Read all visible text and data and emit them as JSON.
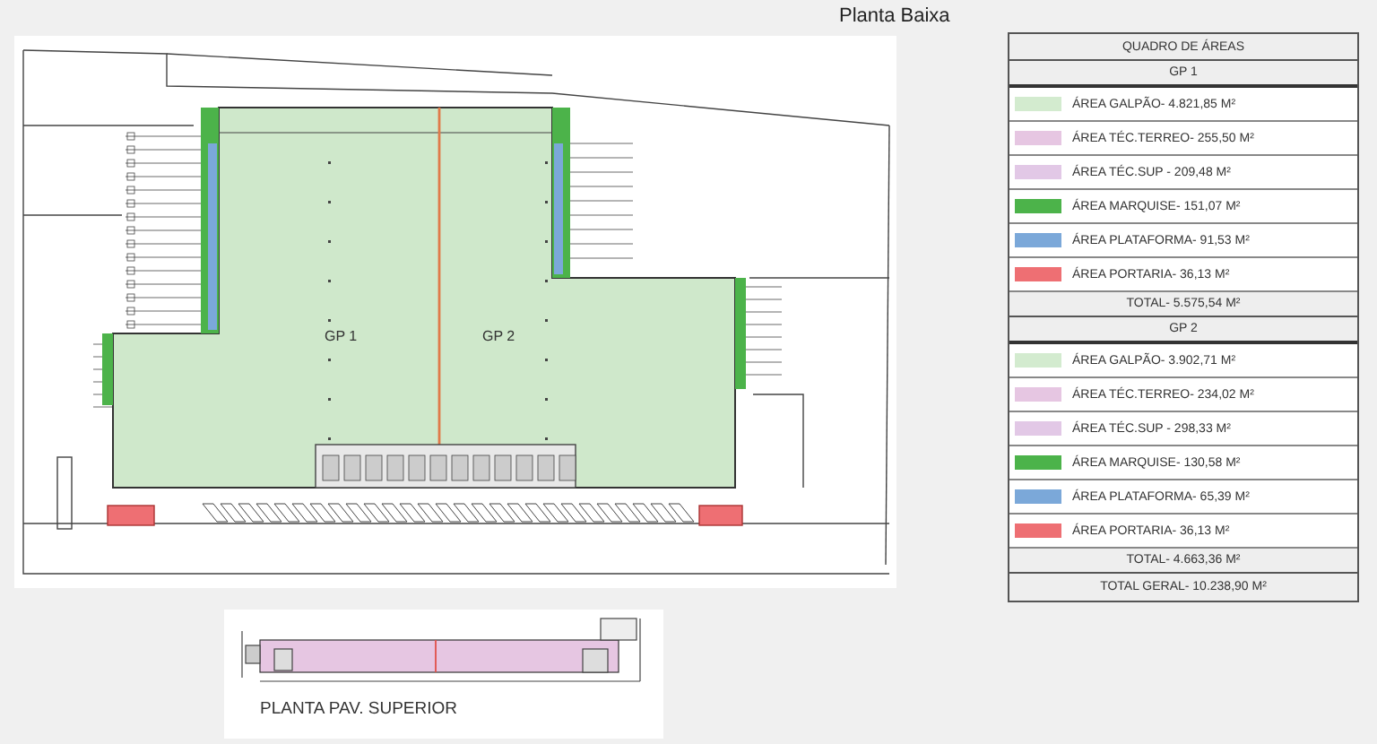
{
  "title": "Planta Baixa",
  "plan": {
    "labels": [
      "GP 1",
      "GP 2"
    ]
  },
  "upper_floor": {
    "caption": "PLANTA PAV. SUPERIOR"
  },
  "table": {
    "title": "QUADRO DE ÁREAS",
    "groups": [
      {
        "name": "GP 1",
        "items": [
          {
            "label": "ÁREA GALPÃO- 4.821,85 M²",
            "color": "#d3ebcf"
          },
          {
            "label": "ÁREA TÉC.TERREO- 255,50 M²",
            "color": "#e6c6e2"
          },
          {
            "label": "ÁREA TÉC.SUP - 209,48 M²",
            "color": "#e2c8e6"
          },
          {
            "label": "ÁREA MARQUISE- 151,07 M²",
            "color": "#4cb34a"
          },
          {
            "label": "ÁREA PLATAFORMA- 91,53 M²",
            "color": "#7ba8d9"
          },
          {
            "label": "ÁREA PORTARIA- 36,13 M²",
            "color": "#ee6f73"
          }
        ],
        "total": "TOTAL- 5.575,54 M²"
      },
      {
        "name": "GP 2",
        "items": [
          {
            "label": "ÁREA GALPÃO- 3.902,71 M²",
            "color": "#d3ebcf"
          },
          {
            "label": "ÁREA TÉC.TERREO- 234,02 M²",
            "color": "#e6c6e2"
          },
          {
            "label": "ÁREA TÉC.SUP - 298,33 M²",
            "color": "#e2c8e6"
          },
          {
            "label": "ÁREA MARQUISE- 130,58 M²",
            "color": "#4cb34a"
          },
          {
            "label": "ÁREA PLATAFORMA- 65,39 M²",
            "color": "#7ba8d9"
          },
          {
            "label": "ÁREA PORTARIA- 36,13 M²",
            "color": "#ee6f73"
          }
        ],
        "total": "TOTAL- 4.663,36 M²"
      }
    ],
    "grand_total": "TOTAL GERAL- 10.238,90 M²"
  }
}
